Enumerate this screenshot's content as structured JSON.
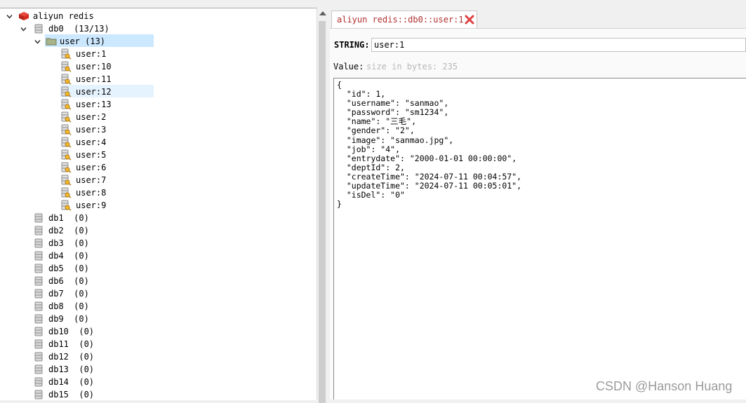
{
  "tree": {
    "server": {
      "label": "aliyun redis",
      "icon": "redis-server-icon"
    },
    "db0": {
      "label": "db0  (13/13)"
    },
    "namespace": {
      "label": "user (13)"
    },
    "keys": [
      {
        "label": "user:1"
      },
      {
        "label": "user:10"
      },
      {
        "label": "user:11"
      },
      {
        "label": "user:12"
      },
      {
        "label": "user:13"
      },
      {
        "label": "user:2"
      },
      {
        "label": "user:3"
      },
      {
        "label": "user:4"
      },
      {
        "label": "user:5"
      },
      {
        "label": "user:6"
      },
      {
        "label": "user:7"
      },
      {
        "label": "user:8"
      },
      {
        "label": "user:9"
      }
    ],
    "databases": [
      {
        "label": "db1  (0)"
      },
      {
        "label": "db2  (0)"
      },
      {
        "label": "db3  (0)"
      },
      {
        "label": "db4  (0)"
      },
      {
        "label": "db5  (0)"
      },
      {
        "label": "db6  (0)"
      },
      {
        "label": "db7  (0)"
      },
      {
        "label": "db8  (0)"
      },
      {
        "label": "db9  (0)"
      },
      {
        "label": "db10  (0)"
      },
      {
        "label": "db11  (0)"
      },
      {
        "label": "db12  (0)"
      },
      {
        "label": "db13  (0)"
      },
      {
        "label": "db14  (0)"
      },
      {
        "label": "db15  (0)"
      }
    ]
  },
  "tab": {
    "label": "aliyun redis::db0::user:1",
    "close_icon": "close-icon"
  },
  "key_view": {
    "type_label": "STRING:",
    "key_name": "user:1",
    "value_label": "Value:",
    "value_hint": "size in bytes: 235",
    "value_text": "{\n  \"id\": 1,\n  \"username\": \"sanmao\",\n  \"password\": \"sm1234\",\n  \"name\": \"三毛\",\n  \"gender\": \"2\",\n  \"image\": \"sanmao.jpg\",\n  \"job\": \"4\",\n  \"entrydate\": \"2000-01-01 00:00:00\",\n  \"deptId\": 2,\n  \"createTime\": \"2024-07-11 00:04:57\",\n  \"updateTime\": \"2024-07-11 00:05:01\",\n  \"isDel\": \"0\"\n}"
  },
  "watermark": "CSDN @Hanson Huang",
  "colors": {
    "selection": "#cce8ff",
    "tab_text": "#b03030",
    "close": "#e04040",
    "redis_red": "#d82c20",
    "folder": "#8a9a6a"
  }
}
